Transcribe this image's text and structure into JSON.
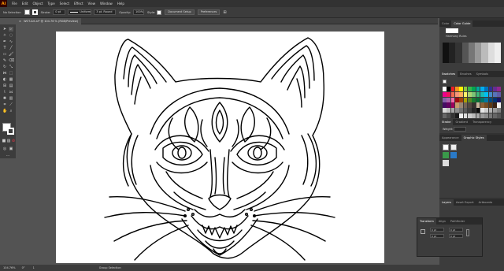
{
  "menu": {
    "app_logo": "Ai",
    "items": [
      "File",
      "Edit",
      "Object",
      "Type",
      "Select",
      "Effect",
      "View",
      "Window",
      "Help"
    ]
  },
  "control_bar": {
    "selection": "No Selection",
    "stroke_label": "Stroke:",
    "stroke_value": "0 pt",
    "profile": "Uniform",
    "brush": "3 pt. Round",
    "opacity_label": "Opacity:",
    "opacity_value": "100%",
    "style_label": "Style:",
    "doc_setup": "Document Setup",
    "preferences": "Preferences"
  },
  "document": {
    "tab_title": "WOT-Art.ai* @ 104.76 % (RGB/Preview)",
    "close": "×"
  },
  "status": {
    "zoom": "104.76%",
    "angle": "0°",
    "artboard": "1",
    "mode": "Group Selection"
  },
  "panels": {
    "color_tabs": [
      "Color",
      "Color Guide"
    ],
    "color_sub": "Harmony Rules",
    "swatch_tabs": [
      "Swatches",
      "Brushes",
      "Symbols"
    ],
    "stroke_tabs": [
      "Stroke",
      "Gradient",
      "Transparency"
    ],
    "stroke_weight_label": "Weight:",
    "appearance_tabs": [
      "Appearance",
      "Graphic Styles"
    ],
    "layers_tabs": [
      "Layers",
      "Asset Export",
      "Artboards"
    ],
    "transform_tabs": [
      "Transform",
      "Align",
      "Pathfinder"
    ],
    "transform_fields": [
      "0 pt",
      "0 pt",
      "0 pt",
      "0 pt"
    ]
  },
  "colors": {
    "accent": "#ff9a00",
    "artboard": "#ffffff",
    "canvas": "#535353"
  }
}
